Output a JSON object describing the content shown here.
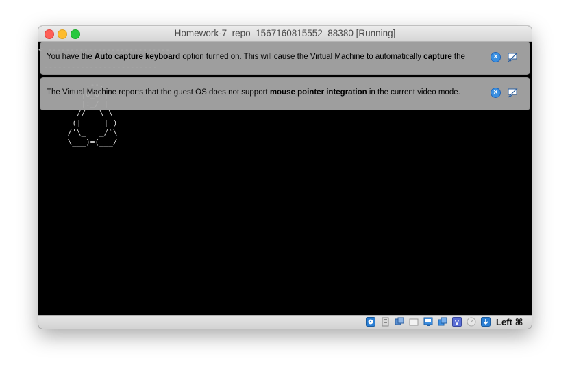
{
  "window": {
    "title": "Homework-7_repo_1567160815552_88380 [Running]"
  },
  "notifications": [
    {
      "parts": [
        {
          "text": "You have the ",
          "bold": false
        },
        {
          "text": "Auto capture keyboard",
          "bold": true
        },
        {
          "text": " option turned on. This will cause the Virtual Machine to automatically ",
          "bold": false
        },
        {
          "text": "capture",
          "bold": true
        },
        {
          "text": " the",
          "bold": false
        }
      ]
    },
    {
      "parts": [
        {
          "text": "The Virtual Machine reports that the guest OS does not support ",
          "bold": false
        },
        {
          "text": "mouse pointer integration",
          "bold": true
        },
        {
          "text": " in the current video mode.",
          "bold": false
        }
      ]
    }
  ],
  "screen": {
    "dash_line_1": "< ---------------------------",
    "dash_line_2": "-------------------------",
    "ascii_art": "     .--.\n    |o_o |\n    |:_/ |\n   //   \\ \\\n  (|     | )\n /'\\_   _/`\\\n \\___)=(___/",
    "ascii_tail": "   \\"
  },
  "statusbar": {
    "icons": [
      "hard-disk-icon",
      "optical-drive-icon",
      "audio-icon",
      "network-icon",
      "usb-icon",
      "shared-folders-icon",
      "display-icon",
      "video-capture-icon",
      "virtualization-icon",
      "mouse-integration-icon",
      "keyboard-capture-icon"
    ],
    "host_key": "Left ⌘"
  }
}
